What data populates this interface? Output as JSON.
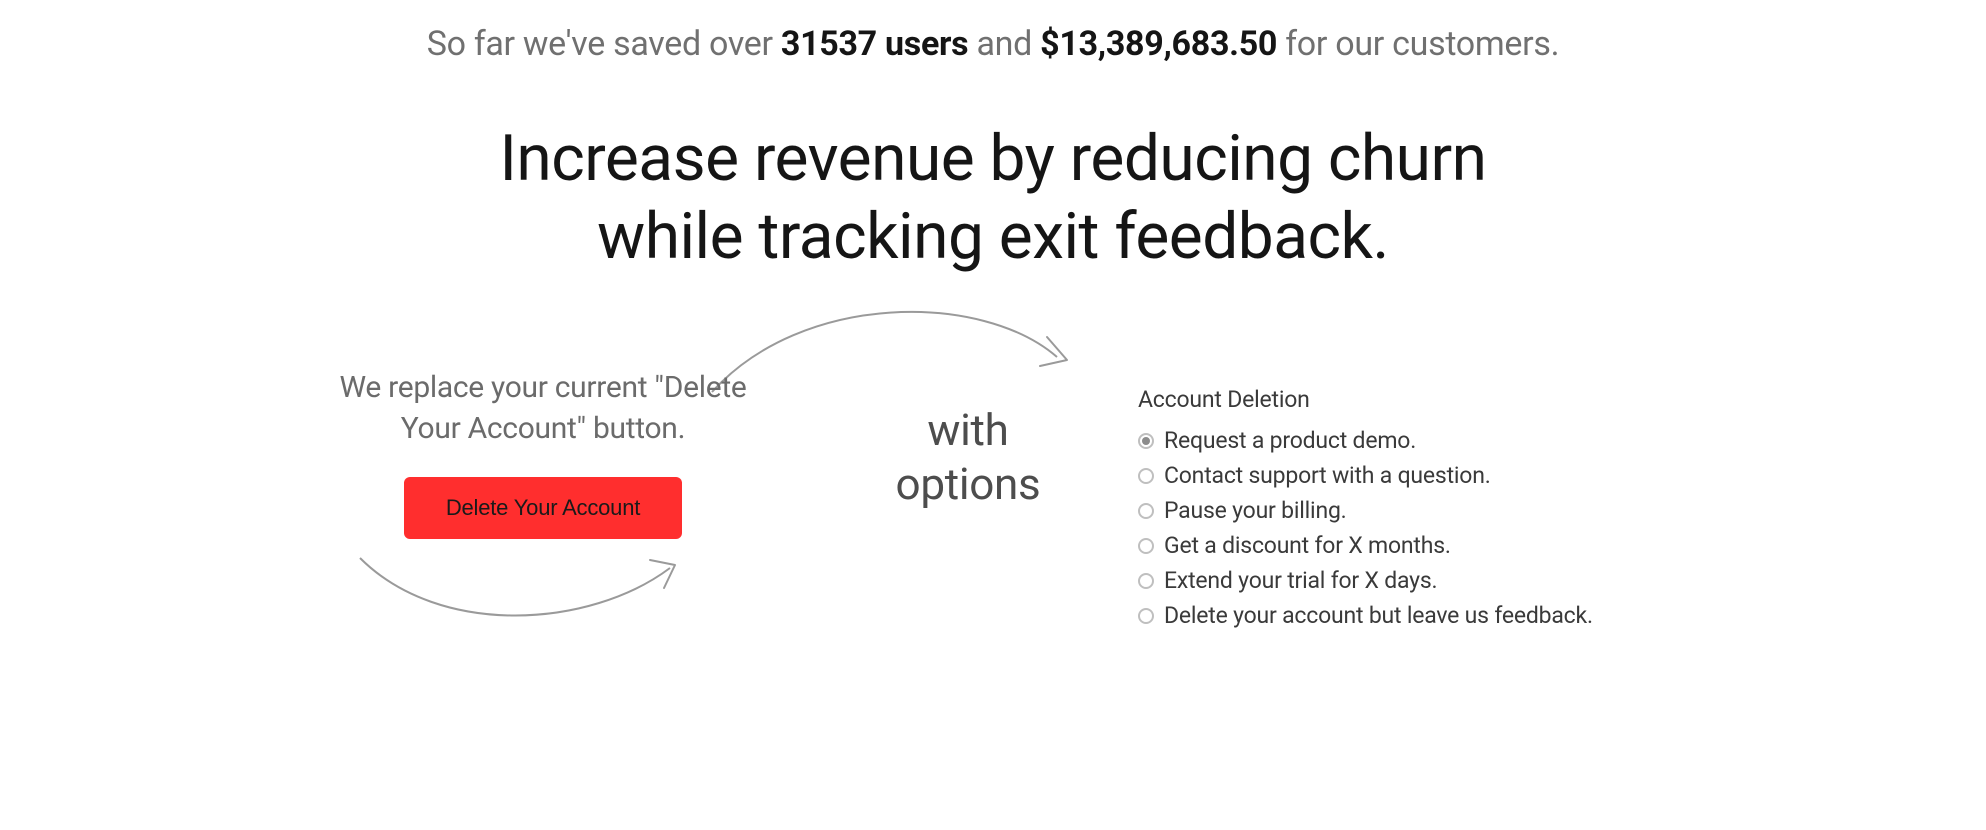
{
  "stats": {
    "prefix": "So far we've saved over ",
    "users": "31537 users",
    "connector": " and ",
    "amount": "$13,389,683.50",
    "suffix": " for our customers."
  },
  "headline_line1": "Increase revenue by reducing churn",
  "headline_line2": "while tracking exit feedback.",
  "left": {
    "replace_text_line1": "We replace your current \"Delete",
    "replace_text_line2": "Your Account\" button.",
    "delete_button_label": "Delete Your Account"
  },
  "middle": {
    "with_line1": "with",
    "with_line2": "options"
  },
  "right": {
    "panel_title": "Account Deletion",
    "options": [
      {
        "label": "Request a product demo.",
        "selected": true
      },
      {
        "label": "Contact support with a question.",
        "selected": false
      },
      {
        "label": "Pause your billing.",
        "selected": false
      },
      {
        "label": "Get a discount for X months.",
        "selected": false
      },
      {
        "label": "Extend your trial for X days.",
        "selected": false
      },
      {
        "label": "Delete your account but leave us feedback.",
        "selected": false
      }
    ]
  }
}
